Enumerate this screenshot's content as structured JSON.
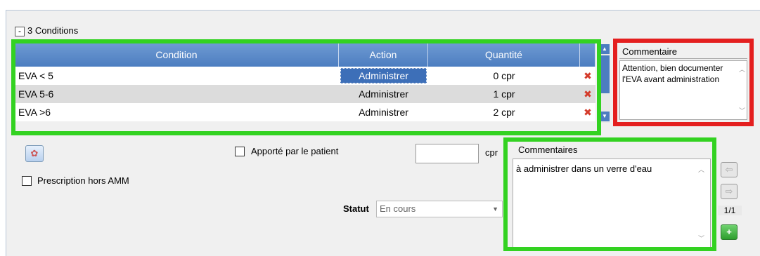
{
  "conditions": {
    "collapse_label": "-",
    "title": "3 Conditions",
    "columns": [
      "Condition",
      "Action",
      "Quantité"
    ],
    "rows": [
      {
        "condition": "EVA < 5",
        "action": "Administrer",
        "quantite": "0 cpr"
      },
      {
        "condition": "EVA 5-6",
        "action": "Administrer",
        "quantite": "1 cpr"
      },
      {
        "condition": "EVA >6",
        "action": "Administrer",
        "quantite": "2 cpr"
      }
    ]
  },
  "commentaire": {
    "title": "Commentaire",
    "text": "Attention, bien documenter l'EVA avant administration"
  },
  "form": {
    "apporte_label": "Apporté par le patient",
    "quantity_unit": "cpr",
    "hors_amm_label": "Prescription hors AMM",
    "statut_label": "Statut",
    "statut_value": "En cours"
  },
  "commentaires": {
    "title": "Commentaires",
    "text": "à administrer dans un verre d'eau",
    "pager": "1/1"
  },
  "colors": {
    "highlight_green": "#33d221",
    "highlight_red": "#e41f1f",
    "header_blue": "#4c7dc0"
  }
}
